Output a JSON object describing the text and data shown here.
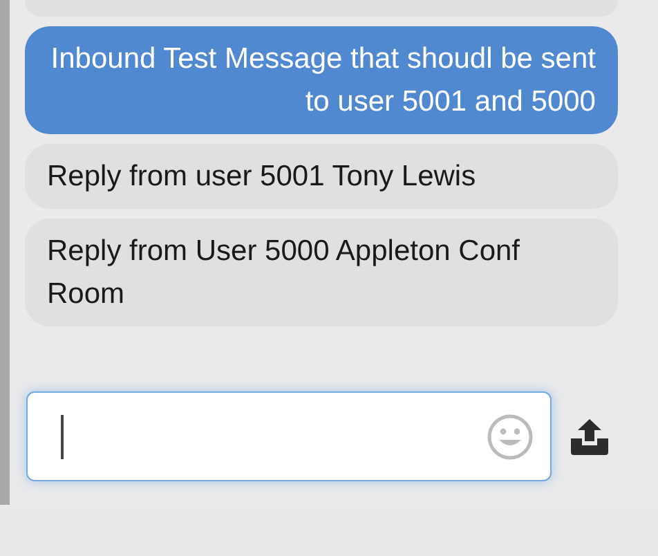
{
  "messages": [
    {
      "kind": "incoming",
      "cut": true
    },
    {
      "kind": "outgoing",
      "text": "Inbound Test Message that shoudl be sent to user 5001 and 5000"
    },
    {
      "kind": "incoming",
      "text": "Reply from user 5001 Tony Lewis"
    },
    {
      "kind": "incoming",
      "text": "Reply from User 5000 Appleton Conf Room"
    }
  ],
  "composer": {
    "focused": true
  }
}
